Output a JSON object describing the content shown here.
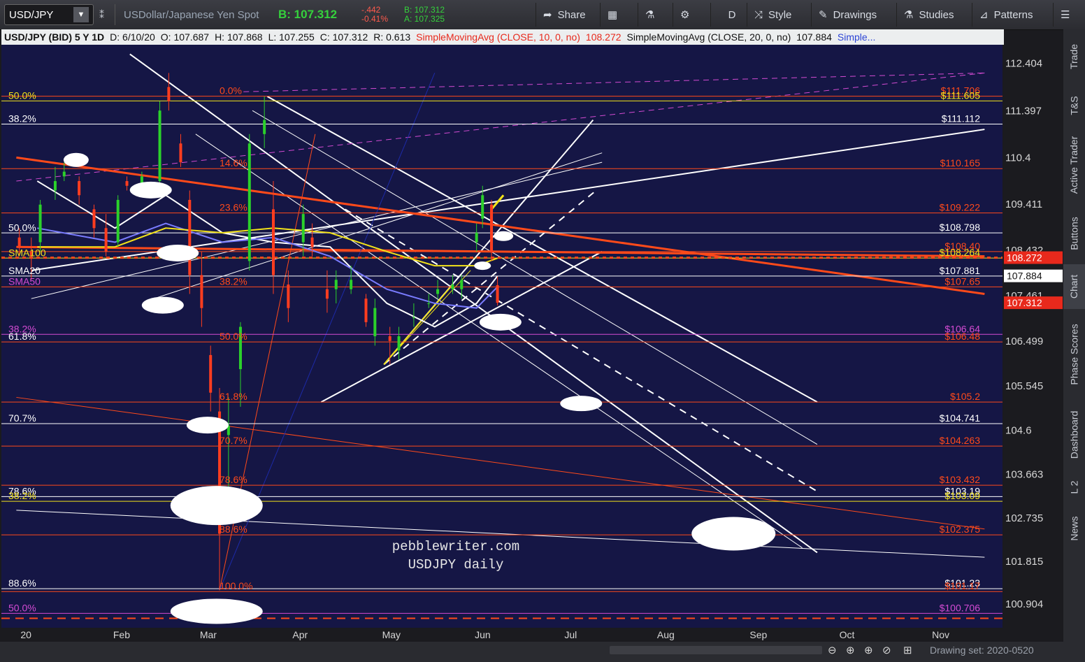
{
  "toolbar": {
    "symbol": "USD/JPY",
    "description": "USDollar/Japanese Yen Spot",
    "bid": "B: 107.312",
    "change": "-.442",
    "change_pct": "-0.41%",
    "bid_small": "B: 107.312",
    "ask_small": "A: 107.325",
    "buttons": [
      "Share",
      "",
      "",
      "",
      "D",
      "Style",
      "Drawings",
      "Studies",
      "Patterns"
    ]
  },
  "info_bar": {
    "title": "USD/JPY (BID) 5 Y 1D",
    "date": "D: 6/10/20",
    "open": "O: 107.687",
    "high": "H: 107.868",
    "low": "L: 107.255",
    "close": "C: 107.312",
    "range": "R: 0.613",
    "sma10": "SimpleMovingAvg (CLOSE, 10, 0, no)",
    "sma10_val": "108.272",
    "sma20": "SimpleMovingAvg (CLOSE, 20, 0, no)",
    "sma20_val": "107.884",
    "more": "Simple..."
  },
  "right_tabs": [
    "Trade",
    "T&S",
    "Active Trader",
    "Buttons",
    "Chart",
    "Phase Scores",
    "Dashboard",
    "L 2",
    "News"
  ],
  "drawing_set": "Drawing set: 2020-0520",
  "watermark": [
    "pebblewriter.com",
    "USDJPY daily"
  ],
  "colors": {
    "plot_bg": "#151645",
    "up": "#2bd12b",
    "down": "#ff3d1f",
    "fib": "#ff4a1a",
    "sma20": "#ffffff",
    "sma50": "#7a7cff",
    "sma100": "#f2e21a"
  },
  "chart_data": {
    "type": "candlestick",
    "title": "USD/JPY (BID) 5 Y 1D",
    "ylim": [
      100.4,
      112.8
    ],
    "x_ticks": [
      "20",
      "Feb",
      "Mar",
      "Apr",
      "May",
      "Jun",
      "Jul",
      "Aug",
      "Sep",
      "Oct",
      "Nov"
    ],
    "y_ticks": [
      "112.404",
      "111.397",
      "110.4",
      "109.411",
      "108.432",
      "107.461",
      "106.499",
      "105.545",
      "104.6",
      "103.663",
      "102.735",
      "101.815",
      "100.904"
    ],
    "price_tags": [
      {
        "label": "108.272",
        "value": 108.272,
        "color": "#e8291c"
      },
      {
        "label": "107.884",
        "value": 107.884,
        "color": "#ffffff"
      },
      {
        "label": "107.312",
        "value": 107.312,
        "color": "#e8291c"
      }
    ],
    "levels": [
      {
        "label": "$111.706",
        "value": 111.706,
        "color": "#ff4a1a"
      },
      {
        "label": "$111.605",
        "value": 111.605,
        "color": "#f2e21a"
      },
      {
        "label": "$111.112",
        "value": 111.112,
        "color": "#ffffff"
      },
      {
        "label": "$110.165",
        "value": 110.165,
        "color": "#ff4a1a"
      },
      {
        "label": "$109.222",
        "value": 109.222,
        "color": "#ff4a1a"
      },
      {
        "label": "$108.798",
        "value": 108.798,
        "color": "#ffffff"
      },
      {
        "label": "$108.40",
        "value": 108.4,
        "color": "#ff4a1a"
      },
      {
        "label": "$108.264",
        "value": 108.264,
        "color": "#f2e21a"
      },
      {
        "label": "$107.881",
        "value": 107.881,
        "color": "#ffffff"
      },
      {
        "label": "$107.65",
        "value": 107.65,
        "color": "#ff4a1a"
      },
      {
        "label": "$106.64",
        "value": 106.64,
        "color": "#d34bd3"
      },
      {
        "label": "$106.48",
        "value": 106.48,
        "color": "#ff4a1a"
      },
      {
        "label": "$105.2",
        "value": 105.2,
        "color": "#ff4a1a"
      },
      {
        "label": "$104.741",
        "value": 104.741,
        "color": "#ffffff"
      },
      {
        "label": "$104.263",
        "value": 104.263,
        "color": "#ff4a1a"
      },
      {
        "label": "$103.432",
        "value": 103.432,
        "color": "#ff4a1a"
      },
      {
        "label": "$103.19",
        "value": 103.19,
        "color": "#ffffff"
      },
      {
        "label": "$103.09",
        "value": 103.09,
        "color": "#f2e21a"
      },
      {
        "label": "$102.375",
        "value": 102.375,
        "color": "#ff4a1a"
      },
      {
        "label": "$101.23",
        "value": 101.23,
        "color": "#ffffff"
      },
      {
        "label": "$101.17",
        "value": 101.17,
        "color": "#ff4a1a"
      },
      {
        "label": "$100.706",
        "value": 100.706,
        "color": "#d34bd3"
      }
    ],
    "fib_left": [
      {
        "label": "50.0%",
        "value": 111.6,
        "color": "#f2e21a"
      },
      {
        "label": "38.2%",
        "value": 111.11,
        "color": "#ffffff"
      },
      {
        "label": "50.0%",
        "value": 108.79,
        "color": "#ffffff"
      },
      {
        "label": "SMA100",
        "value": 108.26,
        "color": "#f2e21a"
      },
      {
        "label": "SMA20",
        "value": 107.88,
        "color": "#ffffff"
      },
      {
        "label": "SMA50",
        "value": 107.65,
        "color": "#d34bd3"
      },
      {
        "label": "38.2%",
        "value": 106.64,
        "color": "#d34bd3"
      },
      {
        "label": "61.8%",
        "value": 106.48,
        "color": "#ffffff"
      },
      {
        "label": "70.7%",
        "value": 104.74,
        "color": "#ffffff"
      },
      {
        "label": "78.6%",
        "value": 103.19,
        "color": "#ffffff"
      },
      {
        "label": "38.2%",
        "value": 103.09,
        "color": "#f2e21a"
      },
      {
        "label": "88.6%",
        "value": 101.23,
        "color": "#ffffff"
      },
      {
        "label": "50.0%",
        "value": 100.706,
        "color": "#d34bd3"
      }
    ],
    "fib_mid": [
      {
        "label": "0.0%",
        "value": 111.706
      },
      {
        "label": "14.6%",
        "value": 110.165
      },
      {
        "label": "23.6%",
        "value": 109.222
      },
      {
        "label": "38.2%",
        "value": 107.65
      },
      {
        "label": "50.0%",
        "value": 106.48
      },
      {
        "label": "61.8%",
        "value": 105.2
      },
      {
        "label": "70.7%",
        "value": 104.263
      },
      {
        "label": "78.6%",
        "value": 103.432
      },
      {
        "label": "88.6%",
        "value": 102.375
      },
      {
        "label": "100.0%",
        "value": 101.17
      }
    ],
    "candles": [
      {
        "date": "2020-01-02",
        "o": 108.7,
        "h": 108.9,
        "l": 108.3,
        "c": 108.5
      },
      {
        "date": "2020-01-06",
        "o": 108.4,
        "h": 108.7,
        "l": 107.8,
        "c": 108.3
      },
      {
        "date": "2020-01-09",
        "o": 108.6,
        "h": 109.5,
        "l": 108.4,
        "c": 109.4
      },
      {
        "date": "2020-01-14",
        "o": 109.7,
        "h": 110.2,
        "l": 109.5,
        "c": 109.9
      },
      {
        "date": "2020-01-17",
        "o": 110.0,
        "h": 110.3,
        "l": 109.9,
        "c": 110.1
      },
      {
        "date": "2020-01-22",
        "o": 109.9,
        "h": 110.0,
        "l": 109.4,
        "c": 109.6
      },
      {
        "date": "2020-01-27",
        "o": 109.3,
        "h": 109.4,
        "l": 108.7,
        "c": 108.9
      },
      {
        "date": "2020-01-31",
        "o": 108.9,
        "h": 109.2,
        "l": 108.3,
        "c": 108.4
      },
      {
        "date": "2020-02-04",
        "o": 108.6,
        "h": 109.6,
        "l": 108.5,
        "c": 109.5
      },
      {
        "date": "2020-02-07",
        "o": 109.9,
        "h": 110.0,
        "l": 109.7,
        "c": 109.8
      },
      {
        "date": "2020-02-12",
        "o": 109.8,
        "h": 110.1,
        "l": 109.7,
        "c": 110.0
      },
      {
        "date": "2020-02-18",
        "o": 109.9,
        "h": 111.6,
        "l": 109.8,
        "c": 111.4
      },
      {
        "date": "2020-02-21",
        "o": 111.9,
        "h": 112.2,
        "l": 111.4,
        "c": 111.6
      },
      {
        "date": "2020-02-25",
        "o": 110.7,
        "h": 110.9,
        "l": 110.2,
        "c": 110.3
      },
      {
        "date": "2020-02-28",
        "o": 109.5,
        "h": 109.7,
        "l": 107.5,
        "c": 107.9
      },
      {
        "date": "2020-03-03",
        "o": 107.9,
        "h": 108.4,
        "l": 106.8,
        "c": 107.2
      },
      {
        "date": "2020-03-06",
        "o": 106.2,
        "h": 106.4,
        "l": 105.0,
        "c": 105.4
      },
      {
        "date": "2020-03-09",
        "o": 105.0,
        "h": 105.5,
        "l": 101.2,
        "c": 102.4
      },
      {
        "date": "2020-03-12",
        "o": 104.5,
        "h": 105.3,
        "l": 103.1,
        "c": 104.7
      },
      {
        "date": "2020-03-16",
        "o": 105.9,
        "h": 106.9,
        "l": 105.1,
        "c": 106.8
      },
      {
        "date": "2020-03-19",
        "o": 108.2,
        "h": 110.9,
        "l": 108.0,
        "c": 110.7
      },
      {
        "date": "2020-03-24",
        "o": 110.9,
        "h": 111.7,
        "l": 110.6,
        "c": 111.2
      },
      {
        "date": "2020-03-27",
        "o": 109.3,
        "h": 109.9,
        "l": 107.5,
        "c": 107.9
      },
      {
        "date": "2020-04-01",
        "o": 107.7,
        "h": 108.0,
        "l": 106.9,
        "c": 107.2
      },
      {
        "date": "2020-04-06",
        "o": 108.6,
        "h": 109.4,
        "l": 108.3,
        "c": 109.2
      },
      {
        "date": "2020-04-09",
        "o": 108.7,
        "h": 109.0,
        "l": 108.3,
        "c": 108.5
      },
      {
        "date": "2020-04-14",
        "o": 107.6,
        "h": 108.0,
        "l": 107.1,
        "c": 107.4
      },
      {
        "date": "2020-04-17",
        "o": 107.6,
        "h": 108.0,
        "l": 107.3,
        "c": 107.8
      },
      {
        "date": "2020-04-22",
        "o": 107.6,
        "h": 108.1,
        "l": 107.5,
        "c": 107.8
      },
      {
        "date": "2020-04-27",
        "o": 107.4,
        "h": 107.5,
        "l": 106.8,
        "c": 106.9
      },
      {
        "date": "2020-04-30",
        "o": 106.6,
        "h": 107.4,
        "l": 106.4,
        "c": 107.2
      },
      {
        "date": "2020-05-05",
        "o": 106.6,
        "h": 106.8,
        "l": 106.0,
        "c": 106.5
      },
      {
        "date": "2020-05-08",
        "o": 106.3,
        "h": 106.8,
        "l": 106.1,
        "c": 106.6
      },
      {
        "date": "2020-05-13",
        "o": 107.0,
        "h": 107.3,
        "l": 106.8,
        "c": 107.0
      },
      {
        "date": "2020-05-18",
        "o": 107.3,
        "h": 107.5,
        "l": 107.2,
        "c": 107.3
      },
      {
        "date": "2020-05-21",
        "o": 107.5,
        "h": 107.8,
        "l": 107.4,
        "c": 107.6
      },
      {
        "date": "2020-05-26",
        "o": 107.6,
        "h": 107.9,
        "l": 107.5,
        "c": 107.7
      },
      {
        "date": "2020-05-29",
        "o": 107.6,
        "h": 107.9,
        "l": 107.4,
        "c": 107.8
      },
      {
        "date": "2020-06-03",
        "o": 108.6,
        "h": 109.0,
        "l": 108.4,
        "c": 108.8
      },
      {
        "date": "2020-06-05",
        "o": 109.1,
        "h": 109.8,
        "l": 108.9,
        "c": 109.6
      },
      {
        "date": "2020-06-08",
        "o": 109.4,
        "h": 109.5,
        "l": 108.2,
        "c": 108.4
      },
      {
        "date": "2020-06-10",
        "o": 107.687,
        "h": 107.868,
        "l": 107.255,
        "c": 107.312
      }
    ],
    "series": [
      {
        "name": "SMA20",
        "color": "#ffffff",
        "points": [
          [
            "2020-01-08",
            109.9
          ],
          [
            "2020-02-03",
            108.9
          ],
          [
            "2020-02-20",
            109.6
          ],
          [
            "2020-03-10",
            108.8
          ],
          [
            "2020-03-27",
            108.6
          ],
          [
            "2020-04-15",
            108.5
          ],
          [
            "2020-05-04",
            107.3
          ],
          [
            "2020-05-20",
            106.8
          ],
          [
            "2020-06-03",
            107.3
          ],
          [
            "2020-06-10",
            107.88
          ]
        ]
      },
      {
        "name": "SMA50",
        "color": "#7a7cff",
        "points": [
          [
            "2020-01-08",
            108.9
          ],
          [
            "2020-02-03",
            108.6
          ],
          [
            "2020-02-20",
            109.0
          ],
          [
            "2020-03-10",
            108.6
          ],
          [
            "2020-03-27",
            108.7
          ],
          [
            "2020-04-15",
            108.3
          ],
          [
            "2020-05-04",
            107.6
          ],
          [
            "2020-05-20",
            107.3
          ],
          [
            "2020-06-03",
            107.2
          ],
          [
            "2020-06-10",
            107.65
          ]
        ]
      },
      {
        "name": "SMA100",
        "color": "#f2e21a",
        "points": [
          [
            "2020-01-08",
            108.5
          ],
          [
            "2020-02-03",
            108.5
          ],
          [
            "2020-02-20",
            108.9
          ],
          [
            "2020-03-10",
            108.8
          ],
          [
            "2020-03-27",
            108.9
          ],
          [
            "2020-04-15",
            108.8
          ],
          [
            "2020-05-04",
            108.4
          ],
          [
            "2020-05-20",
            108.1
          ],
          [
            "2020-06-03",
            108.1
          ],
          [
            "2020-06-10",
            108.26
          ]
        ]
      }
    ],
    "grid": false
  }
}
